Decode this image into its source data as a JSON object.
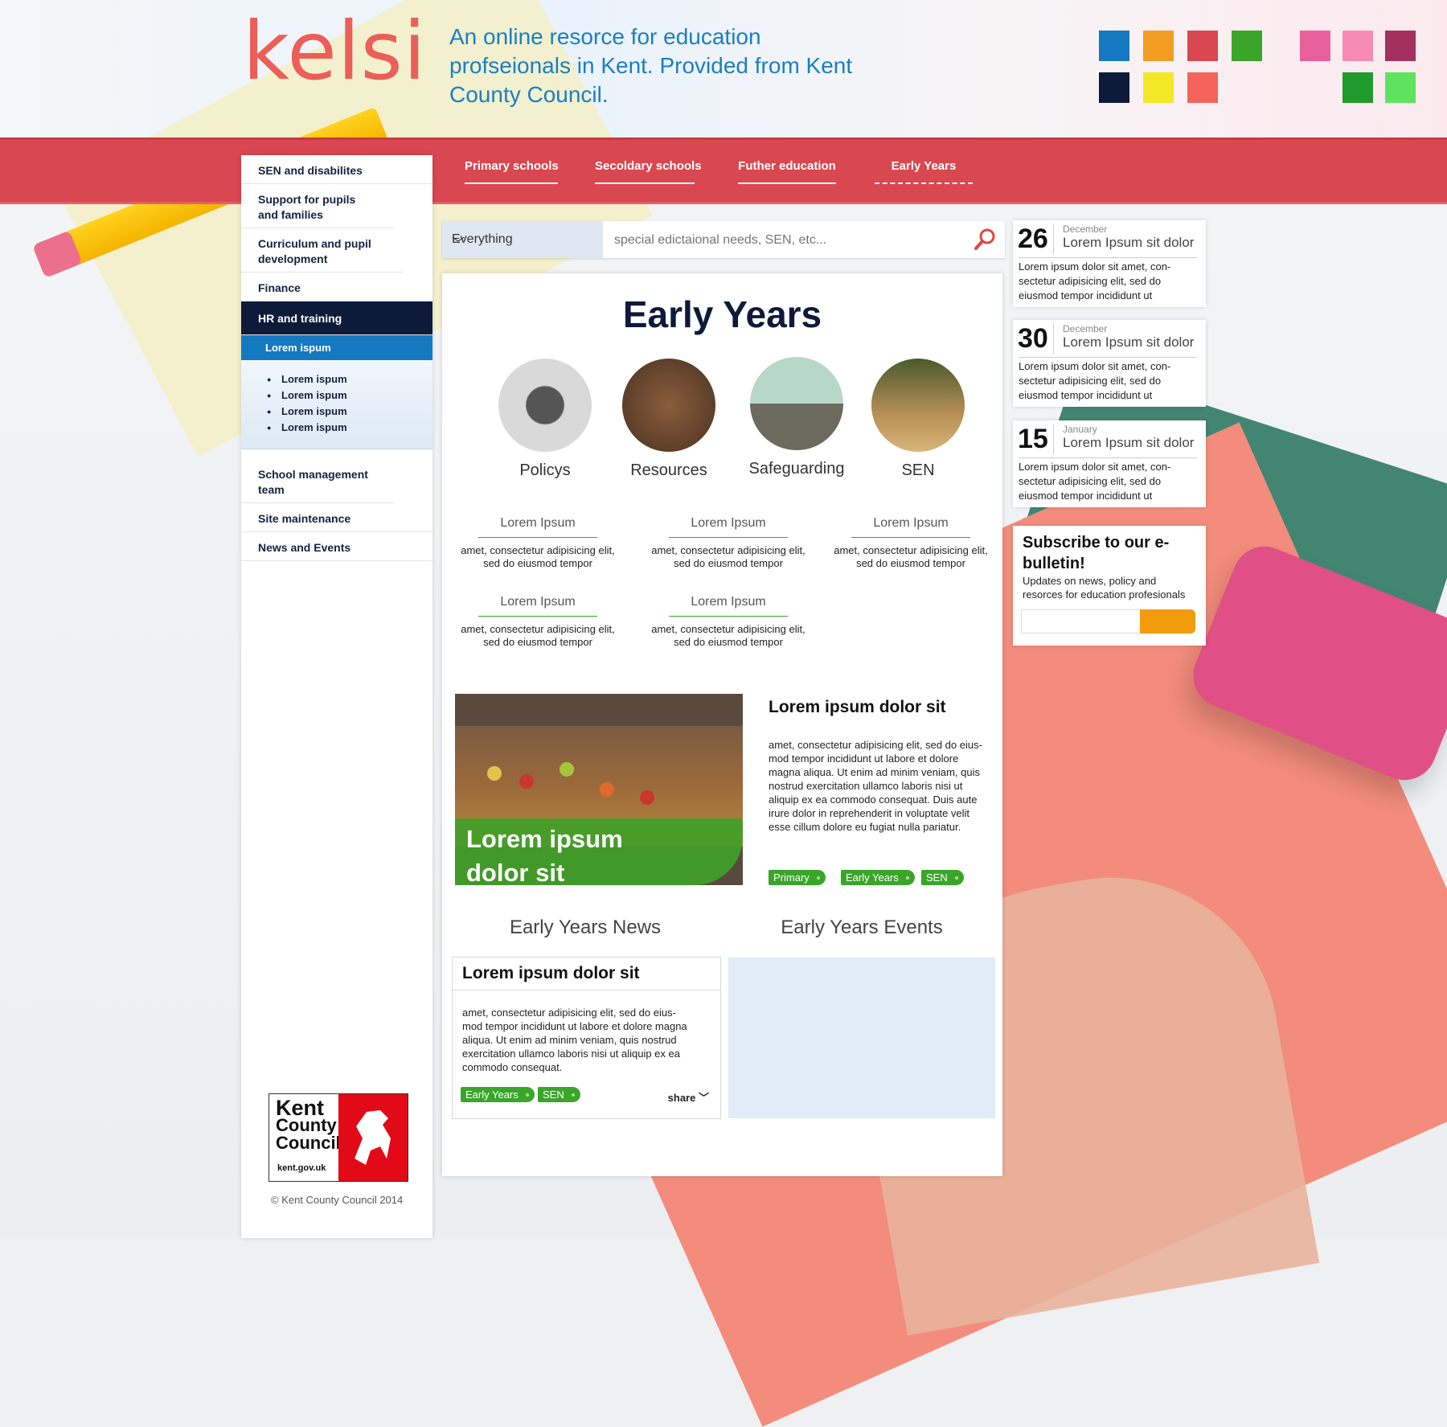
{
  "brand": {
    "logo": "kelsi",
    "tagline": "An online resorce for education profseionals in Kent. Provided from Kent County Council."
  },
  "swatches": [
    "#1479c1",
    "#f39c22",
    "#d94750",
    "#3aa52a",
    "#e9609a",
    "#f78bb6",
    "#a3305e",
    "#0e1a3a",
    "#f3e825",
    "#f4645a",
    "#1f9a2b",
    "#5fe35f"
  ],
  "nav": {
    "tabs": [
      {
        "label": "Primary schools"
      },
      {
        "label": "Secoldary schools"
      },
      {
        "label": "Futher education"
      },
      {
        "label": "Early Years",
        "active": true
      }
    ]
  },
  "sidebar": {
    "items": [
      {
        "label": "SEN and disabilites"
      },
      {
        "label": "Support for pupils and families"
      },
      {
        "label": "Curriculum and pupil development"
      },
      {
        "label": "Finance"
      },
      {
        "label": "HR and training",
        "active": true
      },
      {
        "label": "School management team"
      },
      {
        "label": "Site maintenance"
      },
      {
        "label": "News and Events"
      }
    ],
    "sub_active": "Lorem ispum",
    "sub_items": [
      "Lorem ispum",
      "Lorem ispum",
      "Lorem ispum",
      "Lorem ispum"
    ],
    "footer_logo": {
      "line1": "Kent",
      "line2": "County",
      "line3": "Council",
      "url": "kent.gov.uk"
    },
    "copyright": "© Kent County Council 2014"
  },
  "search": {
    "scope": "Everything",
    "placeholder": "special edictaional needs, SEN, etc..."
  },
  "main": {
    "title": "Early Years",
    "categories": [
      {
        "label": "Policys",
        "icon": "typewriter-icon"
      },
      {
        "label": "Resources",
        "icon": "tools-icon"
      },
      {
        "label": "Safeguarding",
        "icon": "castle-icon"
      },
      {
        "label": "SEN",
        "icon": "grass-icon"
      }
    ],
    "links": [
      {
        "title": "Lorem Ipsum",
        "desc": "amet, consectetur adipisicing elit, sed do eiusmod tempor"
      },
      {
        "title": "Lorem Ipsum",
        "desc": "amet, consectetur adipisicing elit, sed do eiusmod tempor"
      },
      {
        "title": "Lorem Ipsum",
        "desc": "amet, consectetur adipisicing elit, sed do eiusmod tempor"
      },
      {
        "title": "Lorem Ipsum",
        "desc": "amet, consectetur adipisicing elit, sed do eiusmod tempor"
      },
      {
        "title": "Lorem Ipsum",
        "desc": "amet, consectetur adipisicing elit, sed do eiusmod tempor"
      }
    ],
    "feature": {
      "image_caption": "Lorem ipsum dolor sit",
      "heading": "Lorem ipsum dolor sit",
      "body": "amet, consectetur adipisicing elit, sed do eius-mod tempor incididunt ut labore et dolore magna aliqua. Ut enim ad minim veniam, quis nostrud exercitation ullamco laboris nisi ut aliquip ex ea commodo consequat. Duis aute irure dolor in reprehenderit in voluptate velit esse cillum dolore eu fugiat nulla pariatur.",
      "tags": [
        "Primary",
        "Early Years",
        "SEN"
      ]
    },
    "news_heading": "Early Years News",
    "events_heading": "Early Years Events",
    "news_card": {
      "heading": "Lorem ipsum dolor sit",
      "body": "amet, consectetur adipisicing elit, sed do eius-mod tempor incididunt ut labore et dolore magna aliqua. Ut enim ad minim veniam, quis nostrud exercitation ullamco laboris nisi ut aliquip ex ea commodo consequat.",
      "tags": [
        "Early Years",
        "SEN"
      ],
      "share": "share"
    }
  },
  "events": [
    {
      "day": "26",
      "month": "December",
      "title": "Lorem Ipsum sit dolor",
      "text": "Lorem ipsum dolor sit amet, con-sectetur adipisicing elit, sed do eiusmod tempor incididunt ut"
    },
    {
      "day": "30",
      "month": "December",
      "title": "Lorem Ipsum sit dolor",
      "text": "Lorem ipsum dolor sit amet, con-sectetur adipisicing elit, sed do eiusmod tempor incididunt ut"
    },
    {
      "day": "15",
      "month": "January",
      "title": "Lorem Ipsum sit dolor",
      "text": "Lorem ipsum dolor sit amet, con-sectetur adipisicing elit, sed do eiusmod tempor incididunt ut"
    }
  ],
  "subscribe": {
    "heading": "Subscribe to our e-bulletin!",
    "text": "Updates on news, policy and resorces for education profesionals"
  }
}
